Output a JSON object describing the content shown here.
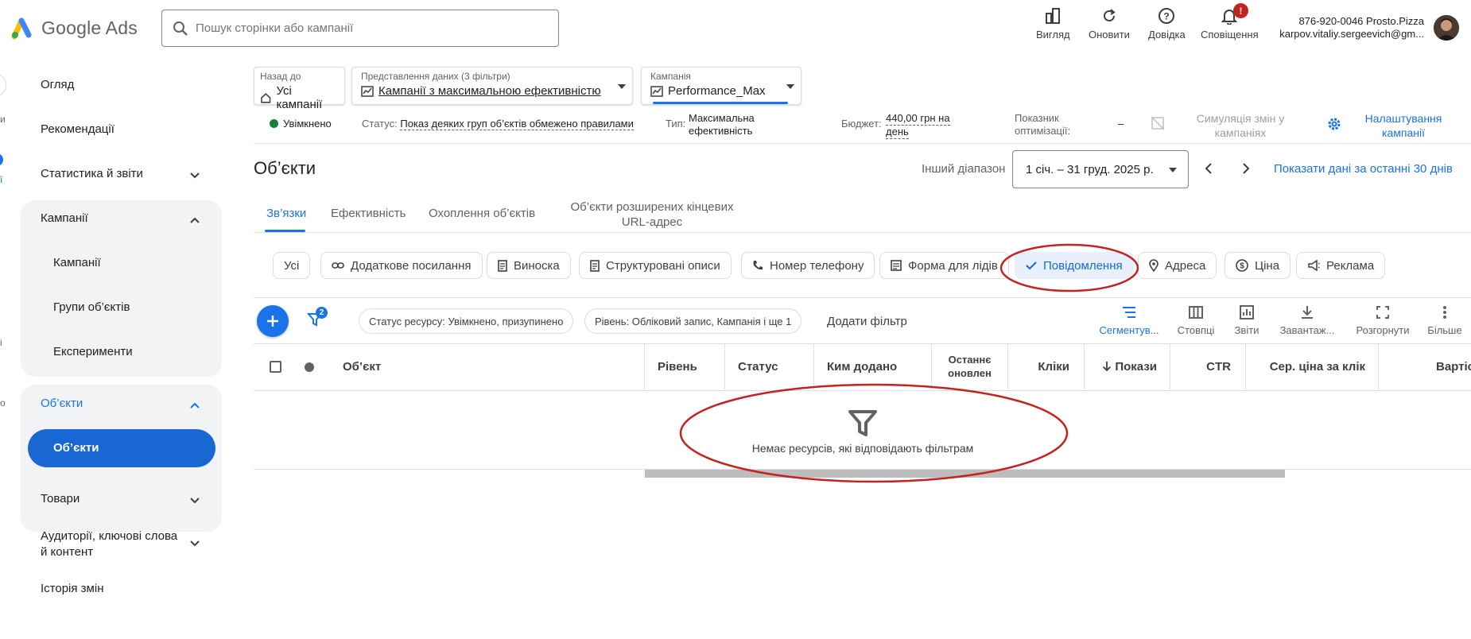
{
  "header": {
    "app_name": "Google Ads",
    "search_placeholder": "Пошук сторінки або кампанії",
    "buttons": {
      "view": "Вигляд",
      "refresh": "Оновити",
      "help": "Довідка",
      "notifications": "Сповіщення"
    },
    "notification_badge": "!",
    "account_line1": "876-920-0046 Prosto.Pizza",
    "account_line2": "karpov.vitaliy.sergeevich@gm..."
  },
  "rail": {
    "frag1": "и",
    "frag2": "ї",
    "frag3": "і",
    "frag4": "о"
  },
  "sidebar": {
    "overview": "Огляд",
    "recommendations": "Рекомендації",
    "stats": "Статистика й звіти",
    "campaigns_group": "Кампанії",
    "campaigns": "Кампанії",
    "ad_groups": "Групи об’єктів",
    "experiments": "Експерименти",
    "assets_group": "Об’єкти",
    "assets": "Об’єкти",
    "products": "Товари",
    "audiences_line1": "Аудиторії, ключові слова",
    "audiences_line2": "й контент",
    "change_history": "Історія змін"
  },
  "breadcrumb": {
    "back_label": "Назад до",
    "back_value": "Усі кампанії",
    "view_label": "Представлення даних (3 фільтри)",
    "view_value": "Кампанії з максимальною ефективністю",
    "campaign_label": "Кампанія",
    "campaign_value": "Performance_Max"
  },
  "status_bar": {
    "enabled": "Увімкнено",
    "status_label": "Статус:",
    "status_value": "Показ деяких груп об’єктів обмежено правилами",
    "type_label": "Тип:",
    "type_value_line1": "Максимальна",
    "type_value_line2": "ефективність",
    "budget_label": "Бюджет:",
    "budget_value_line1": "440,00 грн на",
    "budget_value_line2": "день",
    "opt_label_line1": "Показник",
    "opt_label_line2": "оптимізації:",
    "opt_value": "–",
    "simulation_line1": "Симуляція змін у",
    "simulation_line2": "кампаніях",
    "settings_line1": "Налаштування",
    "settings_line2": "кампанії"
  },
  "page": {
    "title": "Об’єкти",
    "range_label": "Інший діапазон",
    "date_range": "1 січ. – 31 груд. 2025 р.",
    "last30": "Показати дані за останні 30 днів"
  },
  "tabs": [
    "Зв’язки",
    "Ефективність",
    "Охоплення об’єктів"
  ],
  "tab4_line1": "Об’єкти розширених кінцевих",
  "tab4_line2": "URL-адрес",
  "chips": {
    "all": "Усі",
    "sitelink": "Додаткове посилання",
    "callout": "Виноска",
    "structured": "Структуровані описи",
    "phone": "Номер телефону",
    "lead_form": "Форма для лідів",
    "message": "Повідомлення",
    "address": "Адреса",
    "price": "Ціна",
    "promo": "Реклама"
  },
  "filter_badge": "2",
  "filters": {
    "resource_status": "Статус ресурсу: Увімкнено, призупинено",
    "level": "Рівень: Обліковий запис, Кампанія і ще 1",
    "add_filter": "Додати фільтр"
  },
  "tools": {
    "segment": "Сегментув...",
    "columns": "Стовпці",
    "reports": "Звіти",
    "download": "Завантаж...",
    "expand": "Розгорнути",
    "more": "Більше"
  },
  "table": {
    "col_asset": "Об’єкт",
    "col_level": "Рівень",
    "col_status": "Статус",
    "col_added_by": "Ким додано",
    "col_updated_line1": "Останнє",
    "col_updated_line2": "оновлен",
    "col_clicks": "Кліки",
    "col_impressions": "Покази",
    "col_ctr": "CTR",
    "col_cpc": "Сер. ціна за клік",
    "col_cost": "Вартіс",
    "empty_message": "Немає ресурсів, які відповідають фільтрам"
  },
  "colors": {
    "primary": "#1a73e8",
    "annotation": "#c5221f",
    "green": "#188038"
  }
}
